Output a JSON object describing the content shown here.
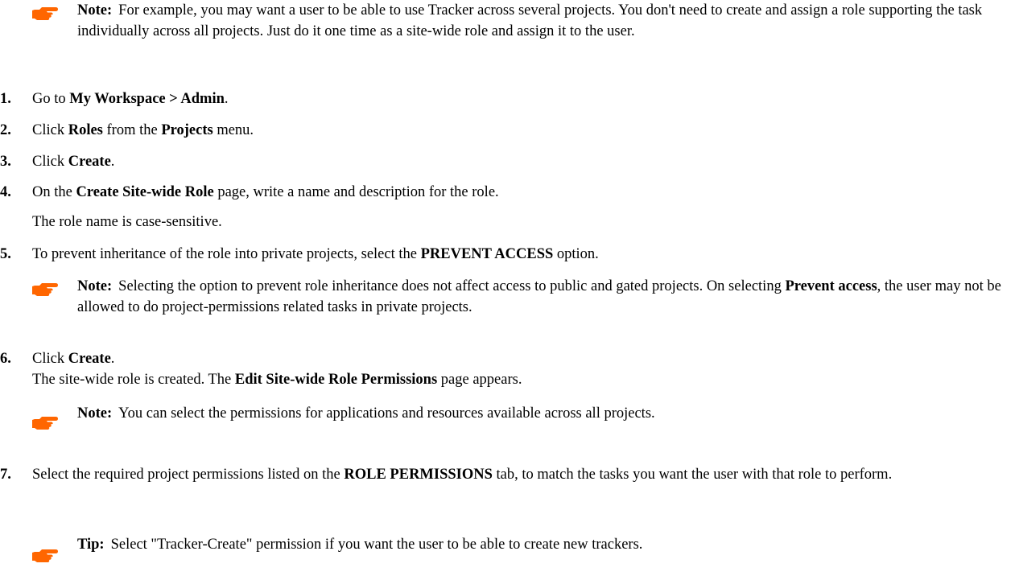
{
  "note_intro": {
    "label": "Note:",
    "text": "For example, you may want a user to be able to use Tracker across several projects. You don't need to create and assign a role supporting the task individually across all projects. Just do it one time as a site-wide role and assign it to the user."
  },
  "steps": [
    {
      "num": "1.",
      "a": "Go to ",
      "b1": "My Workspace > Admin",
      "c": "."
    },
    {
      "num": "2.",
      "a": "Click ",
      "b1": "Roles",
      "c": " from the ",
      "b2": "Projects",
      "d": " menu."
    },
    {
      "num": "3.",
      "a": "Click ",
      "b1": "Create",
      "c": "."
    },
    {
      "num": "4.",
      "a": "On the ",
      "b1": "Create Site-wide Role",
      "c": " page, write a name and description for the role.",
      "sub": "The role name is case-sensitive."
    },
    {
      "num": "5.",
      "a": "To prevent inheritance of the role into private projects, select the ",
      "b1": "PREVENT ACCESS",
      "c": " option."
    },
    {
      "num": "6.",
      "a": "Click ",
      "b1": "Create",
      "c": ".",
      "sub_a": "The site-wide role is created. The ",
      "sub_b": "Edit Site-wide Role Permissions",
      "sub_c": " page appears."
    },
    {
      "num": "7.",
      "a": "Select the required project permissions listed on the ",
      "b1": "ROLE PERMISSIONS",
      "c": " tab, to match the tasks you want the user with that role to perform."
    }
  ],
  "note_step5": {
    "label": "Note:",
    "text_a": "Selecting the option to prevent role inheritance does not affect access to public and gated projects. On selecting ",
    "bold": "Prevent access",
    "text_b": ", the user may not be allowed to do project-permissions related tasks in private projects."
  },
  "note_step6": {
    "label": "Note:",
    "text": "You can select the permissions for applications and resources available across all projects."
  },
  "tip_step7": {
    "label": "Tip:",
    "text": "Select \"Tracker-Create\" permission if you want the user to be able to create new trackers."
  },
  "icons": {
    "note_icon": "pointing-hand-icon",
    "color": "#ff6600"
  }
}
